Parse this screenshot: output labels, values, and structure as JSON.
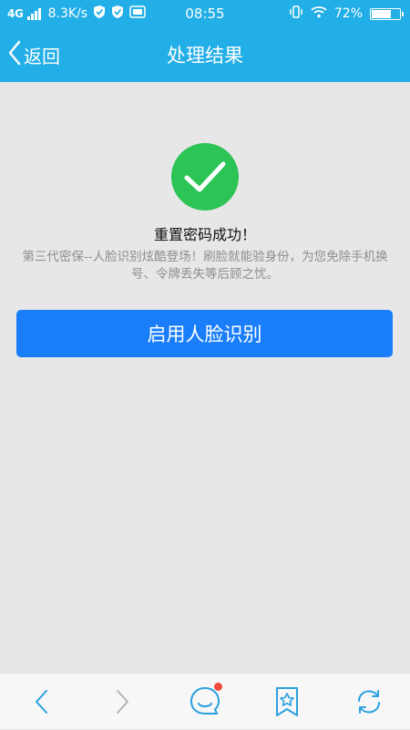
{
  "status_bar": {
    "network": "4G",
    "speed": "8.3K/s",
    "time": "08:55",
    "battery": "72%",
    "battery_level": 0.72,
    "icons": [
      "signal-icon",
      "shield-icon",
      "shield-check-icon",
      "iqiyi-icon",
      "vibrate-icon",
      "wifi-icon",
      "battery-icon"
    ]
  },
  "nav": {
    "back_label": "返回",
    "title": "处理结果"
  },
  "result": {
    "title": "重置密码成功！",
    "description": "第三代密保--人脸识别炫酷登场！刷脸就能验身份，为您免除手机换号、令牌丢失等后顾之忧。",
    "icon": "checkmark-icon"
  },
  "action": {
    "button_label": "启用人脸识别"
  },
  "toolbar": {
    "items": [
      "back-arrow-icon",
      "forward-arrow-icon",
      "chat-icon",
      "bookmark-star-icon",
      "refresh-icon"
    ]
  },
  "colors": {
    "header": "#22aee6",
    "background": "#e7e7e7",
    "success_green": "#2cc455",
    "primary_button": "#1a7efb",
    "toolbar_icon": "#2aa1e0",
    "notification_dot": "#f04a3a"
  }
}
